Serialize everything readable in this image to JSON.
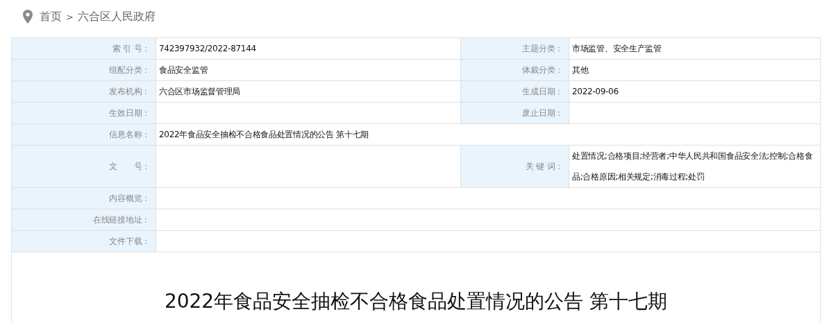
{
  "breadcrumb": {
    "items": [
      "首页",
      "六合区人民政府"
    ],
    "separator": ">"
  },
  "meta": [
    {
      "kind": "pair",
      "cells": [
        {
          "label": "索 引 号：",
          "value": "742397932/2022-87144"
        },
        {
          "label": "主题分类：",
          "value": "市场监管、安全生产监管"
        }
      ]
    },
    {
      "kind": "pair",
      "cells": [
        {
          "label": "组配分类：",
          "value": "食品安全监管"
        },
        {
          "label": "体裁分类：",
          "value": "其他"
        }
      ]
    },
    {
      "kind": "pair",
      "cells": [
        {
          "label": "发布机构：",
          "value": "六合区市场监督管理局"
        },
        {
          "label": "生成日期：",
          "value": "2022-09-06"
        }
      ]
    },
    {
      "kind": "pair",
      "cells": [
        {
          "label": "生效日期："
        },
        {
          "label": "废止日期："
        }
      ]
    },
    {
      "kind": "full",
      "cells": [
        {
          "label": "信息名称：",
          "value": "2022年食品安全抽检不合格食品处置情况的公告 第十七期"
        }
      ]
    },
    {
      "kind": "tall",
      "cells": [
        {
          "label": "文　　号："
        },
        {
          "label": "关 键 词：",
          "value": "处置情况;合格项目;经营者;中华人民共和国食品安全法;控制;合格食品;合格原因;相关规定;消毒过程;处罚"
        }
      ]
    },
    {
      "kind": "full",
      "cells": [
        {
          "label": "内容概览："
        }
      ]
    },
    {
      "kind": "full",
      "cells": [
        {
          "label": "在线链接地址："
        }
      ]
    },
    {
      "kind": "full",
      "cells": [
        {
          "label": "文件下载："
        }
      ]
    }
  ],
  "article": {
    "title": "2022年食品安全抽检不合格食品处置情况的公告 第十七期"
  }
}
